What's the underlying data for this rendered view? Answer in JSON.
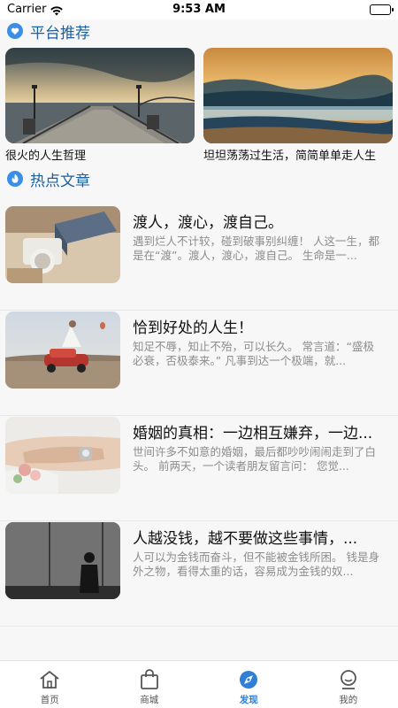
{
  "status_bar": {
    "carrier": "Carrier",
    "time": "9:53 AM"
  },
  "platform": {
    "title": "平台推荐",
    "cards": [
      {
        "caption": "很火的人生哲理"
      },
      {
        "caption": "坦坦荡荡过生活，简简单单走人生"
      }
    ]
  },
  "hot": {
    "title": "热点文章",
    "articles": [
      {
        "title": "渡人，渡心，渡自己。",
        "summary": "遇到烂人不计较，碰到破事别纠缠！ 人这一生，都是在“渡”。渡人，渡心，渡自己。 生命是一..."
      },
      {
        "title": "恰到好处的人生！",
        "summary": "知足不辱，知止不殆，可以长久。 常言道：“盛极必衰，否极泰来。” 凡事到达一个极端，就..."
      },
      {
        "title": "婚姻的真相：一边相互嫌弃，一边...",
        "summary": "世间许多不如意的婚姻，最后都吵吵闹闹走到了白头。 前两天，一个读者朋友留言问： 您觉..."
      },
      {
        "title": "人越没钱，越不要做这些事情，...",
        "summary": "人可以为金钱而奋斗，但不能被金钱所困。 钱是身外之物，看得太重的话，容易成为金钱的奴..."
      }
    ]
  },
  "tabs": [
    {
      "label": "首页",
      "icon": "home-icon"
    },
    {
      "label": "商城",
      "icon": "shopping-bag-icon"
    },
    {
      "label": "发现",
      "icon": "discover-icon",
      "active": true
    },
    {
      "label": "我的",
      "icon": "profile-icon"
    }
  ],
  "colors": {
    "accent": "#2f7fd8",
    "section_title": "#1d5f9d"
  }
}
